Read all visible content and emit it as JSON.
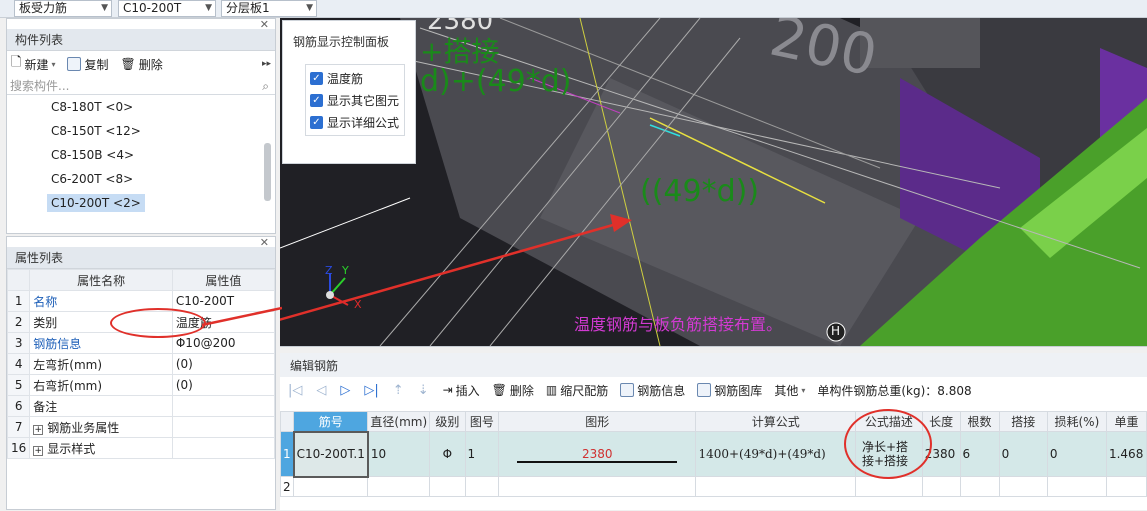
{
  "topbar": {
    "combo1": "板受力筋",
    "combo2": "C10-200T",
    "combo3": "分层板1"
  },
  "component_panel": {
    "title": "构件列表",
    "new_label": "新建",
    "copy_label": "复制",
    "delete_label": "删除",
    "search_placeholder": "搜索构件...",
    "items": [
      "C8-180T <0>",
      "C8-150T <12>",
      "C8-150B <4>",
      "C6-200T <8>",
      "C10-200T <2>"
    ]
  },
  "property_panel": {
    "title": "属性列表",
    "col_name": "属性名称",
    "col_value": "属性值",
    "rows": [
      {
        "num": "1",
        "name": "名称",
        "value": "C10-200T"
      },
      {
        "num": "2",
        "name": "类别",
        "value": "温度筋"
      },
      {
        "num": "3",
        "name": "钢筋信息",
        "value": "Φ10@200"
      },
      {
        "num": "4",
        "name": "左弯折(mm)",
        "value": "(0)"
      },
      {
        "num": "5",
        "name": "右弯折(mm)",
        "value": "(0)"
      },
      {
        "num": "6",
        "name": "备注",
        "value": ""
      },
      {
        "num": "7",
        "name": "钢筋业务属性",
        "value": ""
      },
      {
        "num": "16",
        "name": "显示样式",
        "value": ""
      }
    ]
  },
  "control_panel": {
    "title": "钢筋显示控制面板",
    "checks": [
      "温度筋",
      "显示其它图元",
      "显示详细公式"
    ]
  },
  "view3d": {
    "label_2380": "2380",
    "label_lap": "+搭接",
    "label_formula_top": "d)+(49*d)",
    "label_formula_mid": "((49*d))",
    "label_200": "200",
    "annotation": "温度钢筋与板负筋搭接布置。",
    "axis_x": "X",
    "axis_y": "Y",
    "axis_z": "Z",
    "h_marker": "H"
  },
  "editor": {
    "title": "编辑钢筋",
    "insert": "插入",
    "delete": "删除",
    "scale": "缩尺配筋",
    "info": "钢筋信息",
    "library": "钢筋图库",
    "other": "其他",
    "total_weight": "单构件钢筋总重(kg)：8.808",
    "columns": [
      "筋号",
      "直径(mm)",
      "级别",
      "图号",
      "图形",
      "计算公式",
      "公式描述",
      "长度",
      "根数",
      "搭接",
      "损耗(%)",
      "单重"
    ],
    "rows": [
      {
        "num": "1",
        "id": "C10-200T.1",
        "dia": "10",
        "grade": "Φ",
        "fig": "1",
        "shape": "2380",
        "formula": "1400+(49*d)+(49*d)",
        "desc": "净长+搭接+搭接",
        "length": "2380",
        "count": "6",
        "lap": "0",
        "loss": "0",
        "unit": "1.468"
      },
      {
        "num": "2",
        "id": "",
        "dia": "",
        "grade": "",
        "fig": "",
        "shape": "",
        "formula": "",
        "desc": "",
        "length": "",
        "count": "",
        "lap": "",
        "loss": "",
        "unit": ""
      }
    ]
  },
  "colors": {
    "green_text": "#1a8a1a",
    "magenta_text": "#d23ad2",
    "red_annotation": "#e0302a",
    "selected_row": "#d4e8e8",
    "accent": "#2c6fd1"
  }
}
